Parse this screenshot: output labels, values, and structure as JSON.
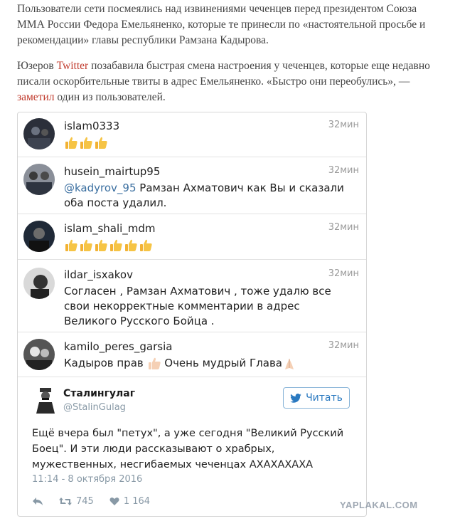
{
  "article": {
    "paragraph1": "Пользователи сети посмеялись над извинениями чеченцев перед президентом Союза ММА России Федора Емельяненко, которые те принесли по «настоятельной просьбе и рекомендации» главы республики Рамзана Кадырова.",
    "paragraph2_pre": "Юзеров ",
    "paragraph2_link": "Twitter",
    "paragraph2_mid": " позабавила быстрая смена настроения у чеченцев, которые еще недавно писали оскорбительные твиты в адрес Емельяненко. «Быстро они переобулись», — ",
    "paragraph2_link2": "заметил",
    "paragraph2_post": " один из пользователей."
  },
  "comments": [
    {
      "username": "islam0333",
      "time": "32мин",
      "text": "",
      "thumbs": 3
    },
    {
      "username": "husein_mairtup95",
      "time": "32мин",
      "mention": "@kadyrov_95",
      "text": " Рамзан Ахматович как Вы и сказали оба поста удалил."
    },
    {
      "username": "islam_shali_mdm",
      "time": "32мин",
      "text": "",
      "thumbs": 6
    },
    {
      "username": "ildar_isxakov",
      "time": "32мин",
      "text": "Согласен , Рамзан Ахматович ,  тоже удалю все свои некорректные комментарии в адрес Великого Русского Бойца ."
    },
    {
      "username": "kamilo_peres_garsia",
      "time": "32мин",
      "text_a": "Кадыров прав ",
      "text_b": " Очень мудрый Глава"
    }
  ],
  "tweet": {
    "name": "Сталингулаг",
    "handle": "@StalinGulag",
    "follow_label": "Читать",
    "text": "Ещё вчера был \"петух\", а уже сегодня \"Великий Русский Боец\". И эти люди рассказывают о храбрых, мужественных, несгибаемых чеченцах АХАХАХАХА",
    "date": "11:14 - 8 октября 2016",
    "retweets": "745",
    "likes": "1 164"
  },
  "watermark": "YAPLAKAL.COM",
  "colors": {
    "link": "#c0392b",
    "mention": "#3b6fa0",
    "twitter_blue": "#2a79c0",
    "muted": "#8899a6"
  }
}
